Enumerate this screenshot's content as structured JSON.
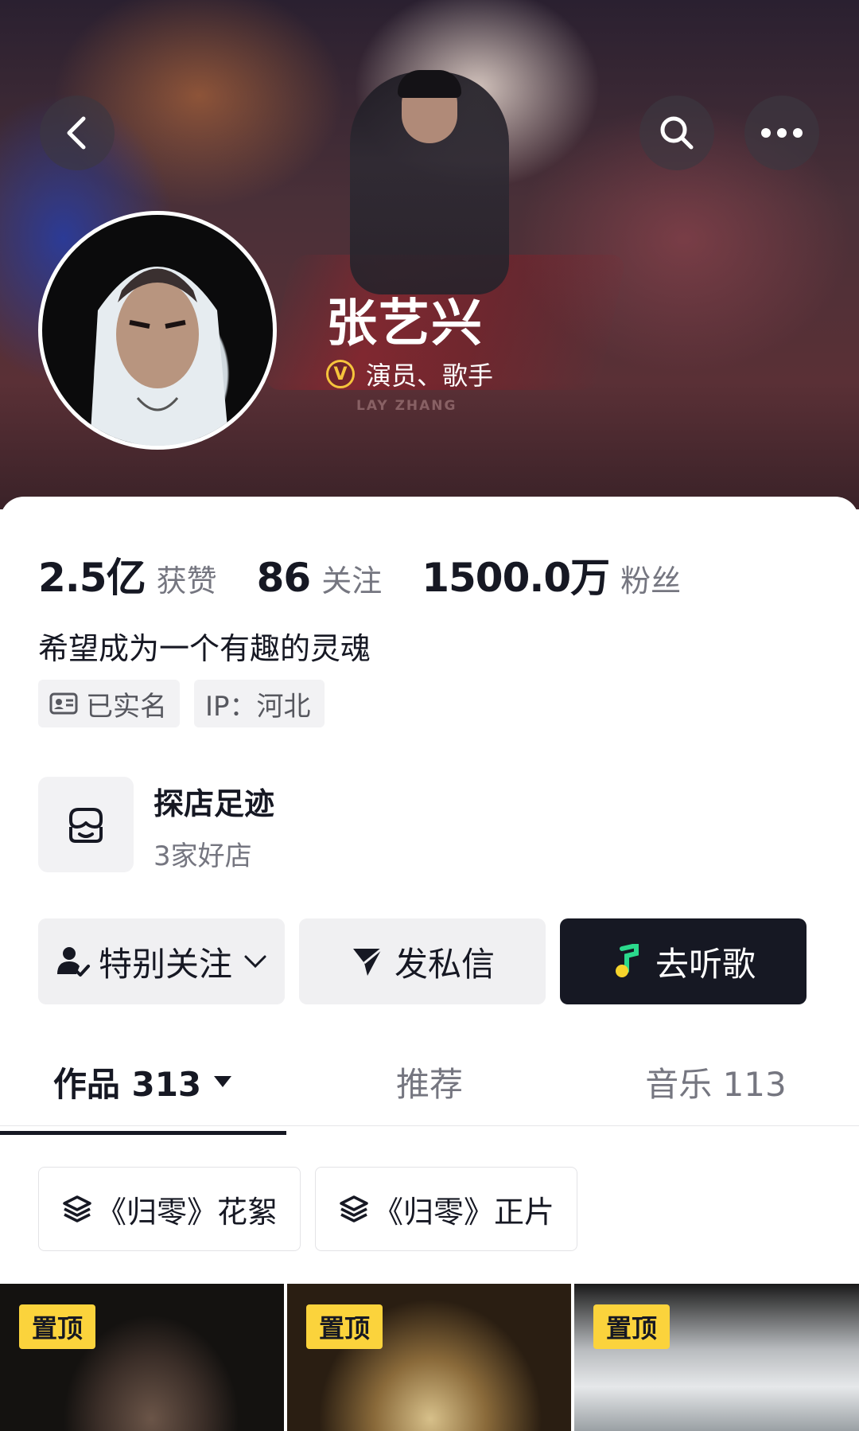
{
  "profile": {
    "name": "张艺兴",
    "verify_badge": "V",
    "verify_text": "演员、歌手",
    "banner_logo": "LAY ZHANG",
    "bio": "希望成为一个有趣的灵魂"
  },
  "stats": [
    {
      "value": "2.5亿",
      "label": "获赞"
    },
    {
      "value": "86",
      "label": "关注"
    },
    {
      "value": "1500.0万",
      "label": "粉丝"
    }
  ],
  "tags": [
    {
      "icon": "id-card-icon",
      "label": "已实名"
    },
    {
      "label": "IP：河北"
    }
  ],
  "shop": {
    "icon": "store-icon",
    "title": "探店足迹",
    "subtitle": "3家好店"
  },
  "actions": {
    "follow": "特别关注",
    "message": "发私信",
    "music": "去听歌"
  },
  "tabs": [
    {
      "label": "作品 313",
      "active": true
    },
    {
      "label": "推荐",
      "active": false
    },
    {
      "label": "音乐 113",
      "active": false
    }
  ],
  "collections": [
    "《归零》花絮",
    "《归零》正片"
  ],
  "videos": [
    {
      "pin": "置顶"
    },
    {
      "pin": "置顶"
    },
    {
      "pin": "置顶"
    }
  ],
  "colors": {
    "accent_dark": "#161823",
    "pin_yellow": "#fbd33c",
    "verify_gold": "#f6c43c"
  }
}
